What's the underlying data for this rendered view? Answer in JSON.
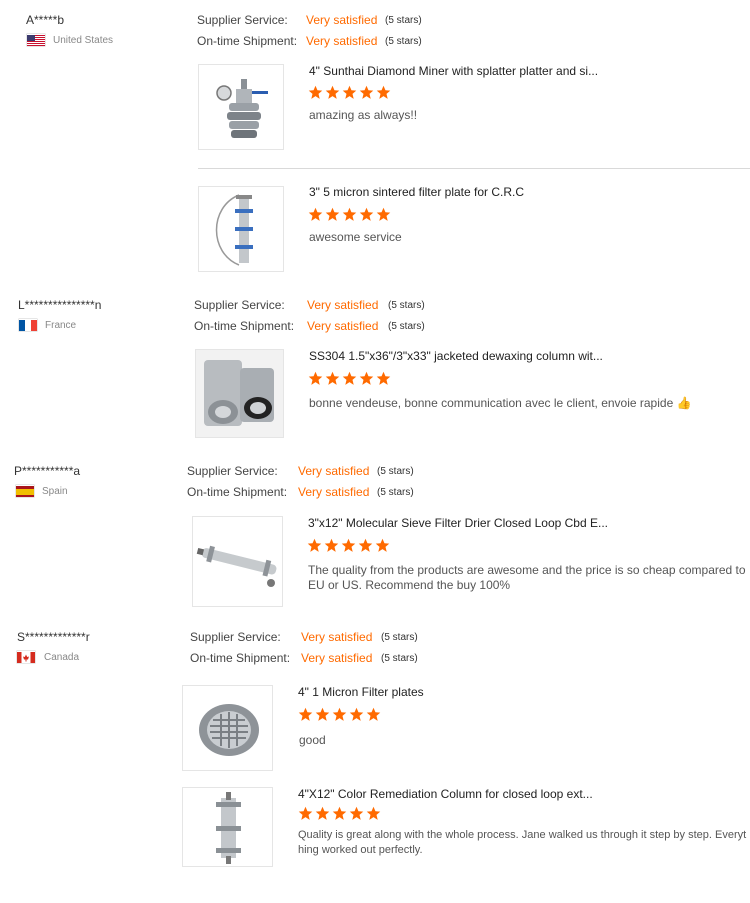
{
  "labels": {
    "supplier_service": "Supplier Service:",
    "ontime_shipment": "On-time Shipment:",
    "very_satisfied": "Very satisfied",
    "five_stars": "(5 stars)"
  },
  "colors": {
    "accent": "#ff6a00",
    "star": "#ff6a00"
  },
  "reviews": [
    {
      "user": "A*****b",
      "country": "United States",
      "flag_icon": "us-flag-icon",
      "products": [
        {
          "title": "4\" Sunthai Diamond Miner with splatter platter and si...",
          "text": "amazing as always!!",
          "image": "diamond-miner-icon"
        },
        {
          "title": "3\" 5 micron sintered filter plate for C.R.C",
          "text": "awesome service",
          "image": "filter-plate-icon"
        }
      ]
    },
    {
      "user": "L***************n",
      "country": "France",
      "flag_icon": "france-flag-icon",
      "products": [
        {
          "title": "SS304 1.5\"x36\"/3\"x33\" jacketed dewaxing column wit...",
          "text": "bonne vendeuse, bonne communication avec le client, envoie rapide",
          "emoji": "👍",
          "image": "dewaxing-column-icon"
        }
      ]
    },
    {
      "user": "P***********a",
      "country": "Spain",
      "flag_icon": "spain-flag-icon",
      "products": [
        {
          "title": "3\"x12\" Molecular Sieve Filter Drier Closed Loop Cbd E...",
          "text": "The quality from the products are awesome and the price is so cheap compared to EU or US. Recommend the buy 100%",
          "image": "sieve-filter-icon"
        }
      ]
    },
    {
      "user": "S*************r",
      "country": "Canada",
      "flag_icon": "canada-flag-icon",
      "products": [
        {
          "title": "4\" 1 Micron Filter plates",
          "text": "good",
          "image": "micron-filter-plate-icon"
        },
        {
          "title": "4\"X12\" Color Remediation Column for closed loop ext...",
          "text": "Quality is great along with the whole process.  Jane walked us through it step by step.  Everything worked out perfectly.",
          "image": "remediation-column-icon"
        }
      ]
    }
  ],
  "rating": {
    "stars": 5,
    "max": 5
  }
}
